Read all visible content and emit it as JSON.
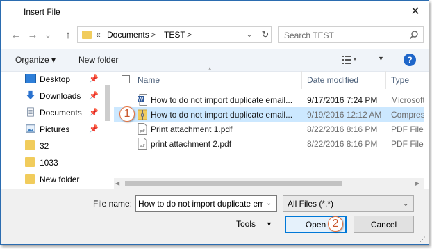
{
  "window": {
    "title": "Insert File",
    "close_glyph": "✕"
  },
  "nav": {
    "back": "←",
    "forward": "→",
    "recent": "⌄",
    "up": "↑"
  },
  "address": {
    "chevron": "«",
    "segments": [
      "Documents",
      "TEST"
    ],
    "separator": ">",
    "dropdown": "⌄",
    "refresh": "↻"
  },
  "search": {
    "placeholder": "Search TEST"
  },
  "toolbar": {
    "organize": "Organize ▾",
    "new_folder": "New folder",
    "view_drop": "▼",
    "help": "?"
  },
  "sidebar": {
    "items": [
      {
        "label": "Desktop",
        "icon": "desktop-icon",
        "pinned": true
      },
      {
        "label": "Downloads",
        "icon": "download-icon",
        "pinned": true
      },
      {
        "label": "Documents",
        "icon": "documents-icon",
        "pinned": true
      },
      {
        "label": "Pictures",
        "icon": "pictures-icon",
        "pinned": true
      },
      {
        "label": "32",
        "icon": "folder-icon",
        "pinned": false
      },
      {
        "label": "1033",
        "icon": "folder-icon",
        "pinned": false
      },
      {
        "label": "New folder",
        "icon": "folder-icon",
        "pinned": false
      }
    ],
    "pin_glyph": "📌"
  },
  "columns": {
    "name": "Name",
    "date": "Date modified",
    "type": "Type",
    "sort_glyph": "^"
  },
  "files": [
    {
      "name": "How to do not import duplicate email...",
      "date": "9/17/2016 7:24 PM",
      "type": "Microsoft",
      "icon": "word-doc-icon",
      "selected": false
    },
    {
      "name": "How to do not import duplicate email...",
      "date": "9/19/2016 12:12 AM",
      "type": "Compress",
      "icon": "zip-folder-icon",
      "selected": true
    },
    {
      "name": "Print attachment 1.pdf",
      "date": "8/22/2016 8:16 PM",
      "type": "PDF File",
      "icon": "pdf-icon",
      "selected": false
    },
    {
      "name": "print attachment 2.pdf",
      "date": "8/22/2016 8:16 PM",
      "type": "PDF File",
      "icon": "pdf-icon",
      "selected": false
    }
  ],
  "footer": {
    "file_name_label": "File name:",
    "file_name_value": "How to do not import duplicate email",
    "filter": "All Files (*.*)",
    "tools": "Tools",
    "open": "Open",
    "cancel": "Cancel"
  },
  "callouts": [
    "1",
    "2"
  ],
  "colors": {
    "selection": "#cce8ff",
    "accent": "#0078d7",
    "callout": "#e8713c",
    "folder": "#f1cc5c"
  }
}
